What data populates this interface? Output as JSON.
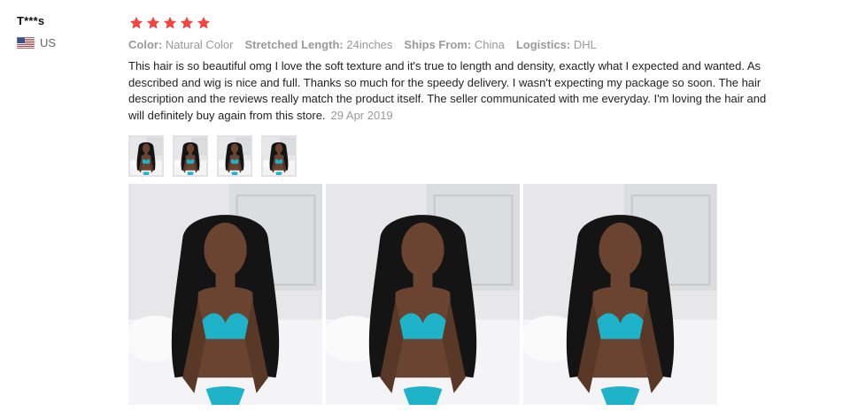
{
  "reviewer": {
    "name": "T***s",
    "country": "US",
    "flag_icon": "us-flag-icon"
  },
  "rating": {
    "stars": 5,
    "max": 5,
    "star_color": "#f0463f"
  },
  "attributes": [
    {
      "label": "Color:",
      "value": "Natural Color"
    },
    {
      "label": "Stretched Length:",
      "value": "24inches"
    },
    {
      "label": "Ships From:",
      "value": "China"
    },
    {
      "label": "Logistics:",
      "value": "DHL"
    }
  ],
  "review": {
    "text": "This hair is so beautiful omg I love the soft texture and it's true to length and density, exactly what I expected and wanted. As described and wig is nice and full.  Thanks so much for the speedy delivery. I wasn't expecting my package so soon. The hair description and the reviews really match the product itself. The seller communicated with me everyday. I'm loving the hair and will definitely buy again from this store.",
    "date": "29 Apr 2019"
  },
  "thumbnails_count": 4,
  "photos_count": 3,
  "colors": {
    "muted_text": "#999999",
    "thumb_border": "#e3e3e3"
  }
}
